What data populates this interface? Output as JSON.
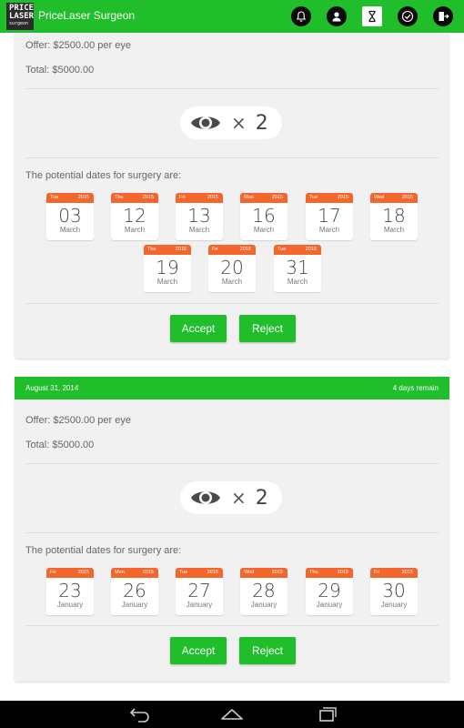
{
  "app": {
    "title": "PriceLaser Surgeon",
    "logo_lines": [
      "PRICE",
      "LASER",
      "surgeon"
    ]
  },
  "toolbar_icons": [
    "bell-icon",
    "profile-icon",
    "hourglass-icon",
    "check-icon",
    "logout-icon"
  ],
  "colors": {
    "primary": "#1fbe2a",
    "calendar_header": "#f4662c",
    "card_bg": "#f1f1f1"
  },
  "card1": {
    "offer": "Offer: $2500.00 per eye",
    "total": "Total: $5000.00",
    "eye_count": "2",
    "times": "×",
    "dates_label": "The potential dates for surgery are:",
    "dates": [
      {
        "weekday": "Tue",
        "year": "2015",
        "day": "03",
        "month": "March"
      },
      {
        "weekday": "Thu",
        "year": "2015",
        "day": "12",
        "month": "March"
      },
      {
        "weekday": "Fri",
        "year": "2015",
        "day": "13",
        "month": "March"
      },
      {
        "weekday": "Mon",
        "year": "2015",
        "day": "16",
        "month": "March"
      },
      {
        "weekday": "Tue",
        "year": "2015",
        "day": "17",
        "month": "March"
      },
      {
        "weekday": "Wed",
        "year": "2015",
        "day": "18",
        "month": "March"
      },
      {
        "weekday": "Thu",
        "year": "2015",
        "day": "19",
        "month": "March"
      },
      {
        "weekday": "Fri",
        "year": "2015",
        "day": "20",
        "month": "March"
      },
      {
        "weekday": "Tue",
        "year": "2015",
        "day": "31",
        "month": "March"
      }
    ],
    "accept_label": "Accept",
    "reject_label": "Reject"
  },
  "card2": {
    "header_date": "August 31, 2014",
    "header_remaining": "4 days remain",
    "offer": "Offer: $2500.00 per eye",
    "total": "Total: $5000.00",
    "eye_count": "2",
    "times": "×",
    "dates_label": "The potential dates for surgery are:",
    "dates": [
      {
        "weekday": "Fri",
        "year": "2015",
        "day": "23",
        "month": "January"
      },
      {
        "weekday": "Mon",
        "year": "2015",
        "day": "26",
        "month": "January"
      },
      {
        "weekday": "Tue",
        "year": "2015",
        "day": "27",
        "month": "January"
      },
      {
        "weekday": "Wed",
        "year": "2015",
        "day": "28",
        "month": "January"
      },
      {
        "weekday": "Thu",
        "year": "2015",
        "day": "29",
        "month": "January"
      },
      {
        "weekday": "Fri",
        "year": "2015",
        "day": "30",
        "month": "January"
      }
    ],
    "accept_label": "Accept",
    "reject_label": "Reject"
  },
  "navbar_icons": [
    "back-icon",
    "home-icon",
    "recents-icon"
  ]
}
